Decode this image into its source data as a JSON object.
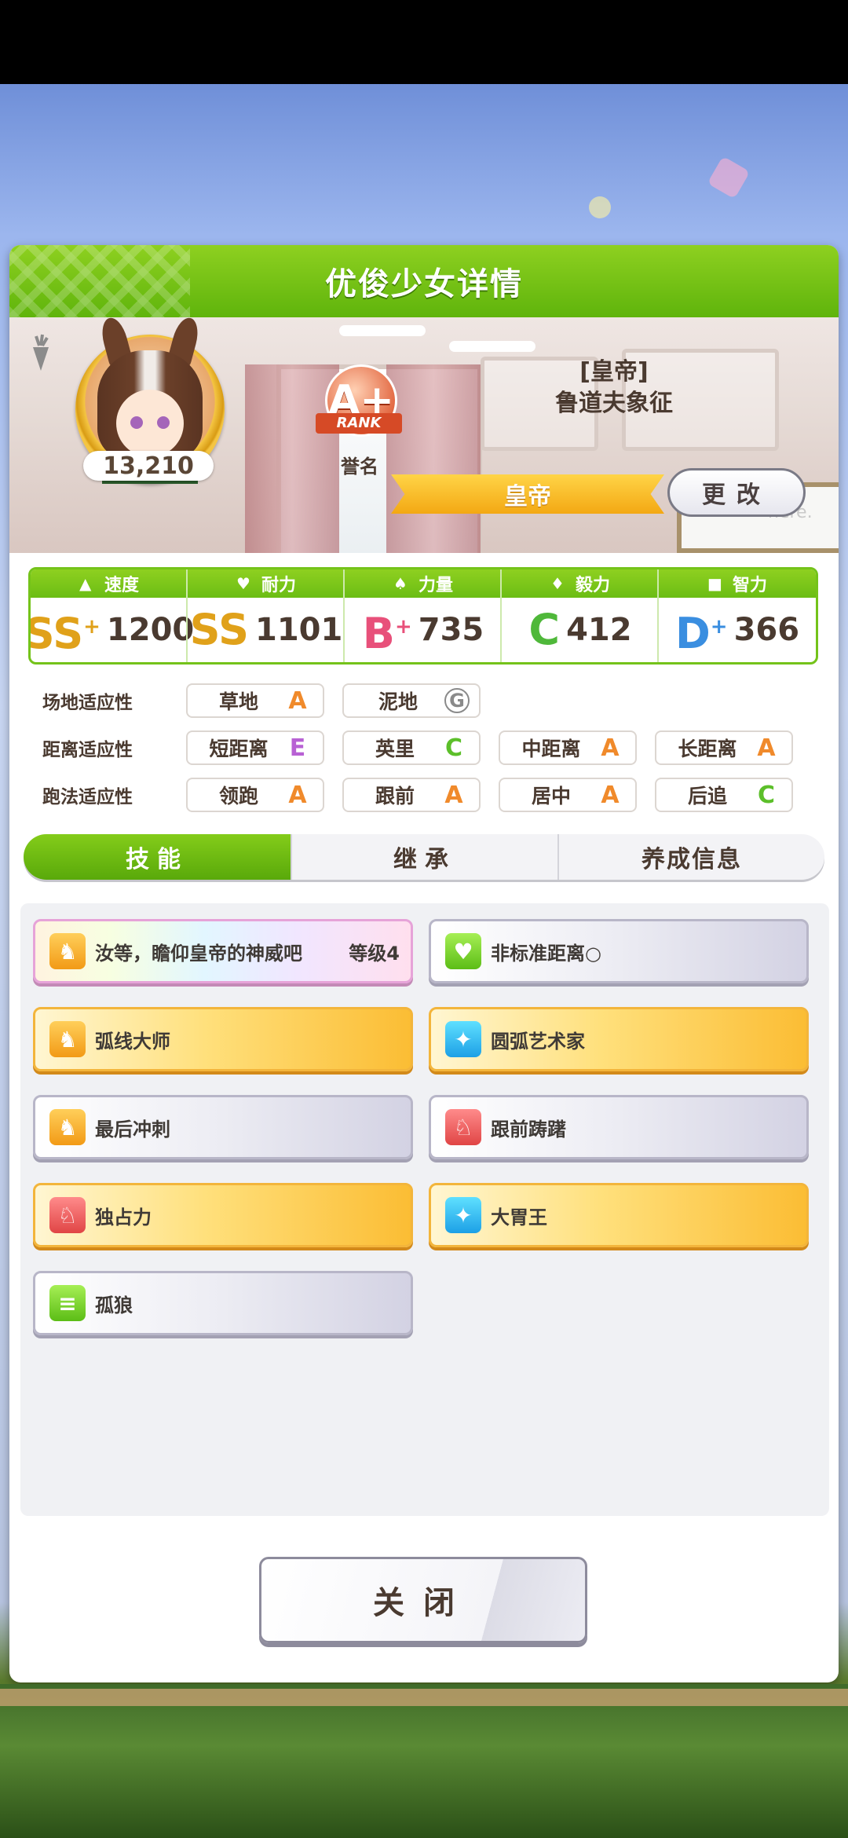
{
  "window": {
    "title": "优俊少女详情"
  },
  "character": {
    "fans": "13,210",
    "rank": {
      "grade": "A+",
      "ribbon": "RANK",
      "caption": "誉名"
    },
    "epithet": "[皇帝]",
    "name": "鲁道夫象征",
    "title_banner": "皇帝",
    "change_button": "更改",
    "board_text": "here."
  },
  "stats": [
    {
      "label": "速度",
      "icon": "shoe-icon",
      "grade": "SS",
      "plus": "+",
      "value": "1200",
      "color": "#e0a11a"
    },
    {
      "label": "耐力",
      "icon": "heart-icon",
      "grade": "SS",
      "plus": "",
      "value": "1101",
      "color": "#e0a11a"
    },
    {
      "label": "力量",
      "icon": "muscle-icon",
      "grade": "B",
      "plus": "+",
      "value": "735",
      "color": "#e8507a"
    },
    {
      "label": "毅力",
      "icon": "flame-icon",
      "grade": "C",
      "plus": "",
      "value": "412",
      "color": "#4fb83a"
    },
    {
      "label": "智力",
      "icon": "graduation-cap-icon",
      "grade": "D",
      "plus": "+",
      "value": "366",
      "color": "#3a8ee0"
    }
  ],
  "aptitude": {
    "field": {
      "label": "场地适应性",
      "items": [
        {
          "name": "草地",
          "grade": "A"
        },
        {
          "name": "泥地",
          "grade": "G"
        }
      ]
    },
    "distance": {
      "label": "距离适应性",
      "items": [
        {
          "name": "短距离",
          "grade": "E"
        },
        {
          "name": "英里",
          "grade": "C"
        },
        {
          "name": "中距离",
          "grade": "A"
        },
        {
          "name": "长距离",
          "grade": "A"
        }
      ]
    },
    "style": {
      "label": "跑法适应性",
      "items": [
        {
          "name": "领跑",
          "grade": "A"
        },
        {
          "name": "跟前",
          "grade": "A"
        },
        {
          "name": "居中",
          "grade": "A"
        },
        {
          "name": "后追",
          "grade": "C"
        }
      ]
    }
  },
  "tabs": [
    "技能",
    "继承",
    "养成信息"
  ],
  "skills": [
    {
      "name": "汝等，瞻仰皇帝的神威吧",
      "level": "等级4",
      "style": "rainbow",
      "icon": "orange"
    },
    {
      "name": "非标准距离○",
      "level": "",
      "style": "white",
      "icon": "green"
    },
    {
      "name": "弧线大师",
      "level": "",
      "style": "gold",
      "icon": "orange"
    },
    {
      "name": "圆弧艺术家",
      "level": "",
      "style": "gold",
      "icon": "blue"
    },
    {
      "name": "最后冲刺",
      "level": "",
      "style": "white",
      "icon": "orange"
    },
    {
      "name": "跟前踌躇",
      "level": "",
      "style": "white",
      "icon": "red"
    },
    {
      "name": "独占力",
      "level": "",
      "style": "gold",
      "icon": "red"
    },
    {
      "name": "大胃王",
      "level": "",
      "style": "gold",
      "icon": "blue"
    },
    {
      "name": "孤狼",
      "level": "",
      "style": "white",
      "icon": "green"
    }
  ],
  "close_button": "关闭"
}
